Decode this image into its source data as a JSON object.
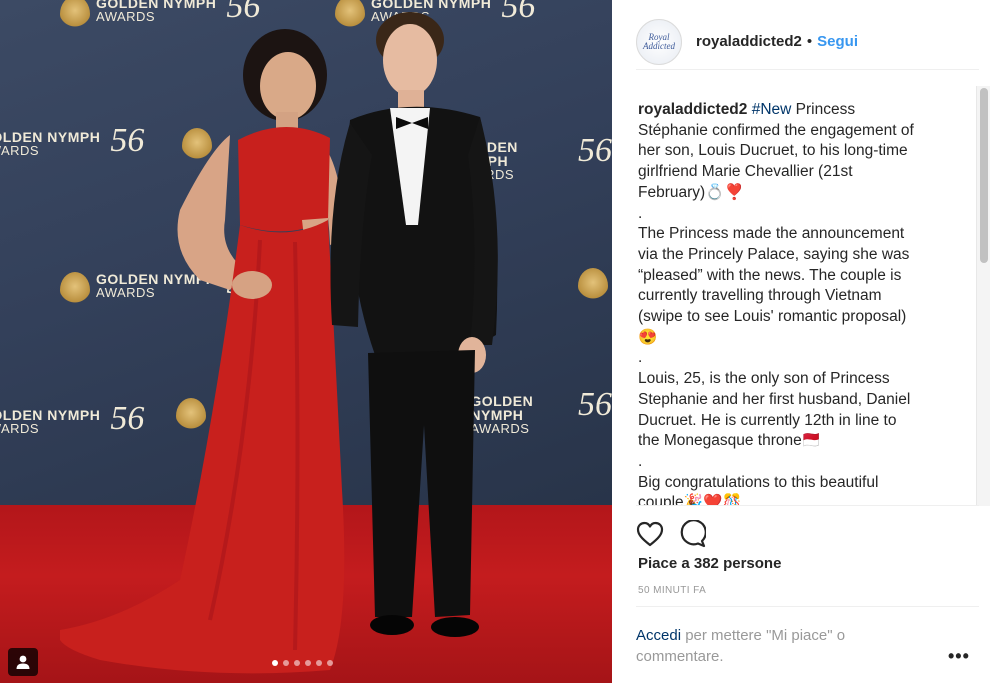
{
  "post": {
    "username": "royaladdicted2",
    "separator": "•",
    "follow_label": "Segui",
    "avatar_text": "Royal Addicted",
    "caption_author": "royaladdicted2",
    "caption_hashtag": "#New",
    "caption_lines": [
      " Princess\nStéphanie confirmed the engagement of\nher son, Louis Ducruet, to his long-time\ngirlfriend Marie Chevallier (21st\nFebruary)💍❣️\n.\nThe Princess made the announcement\nvia the Princely Palace, saying she was\n“pleased” with the news. The couple is\ncurrently travelling through Vietnam\n(swipe to see Louis' romantic proposal)\n😍\n.\nLouis, 25, is the only son of Princess\nStephanie and her first husband, Daniel\nDucruet. He is currently 12th in line to\nthe Monegasque throne🇲🇨\n.\nBig congratulations to this beautiful\ncouple🎉❤️🎊"
    ],
    "likes_text": "Piace a 382 persone",
    "time_text": "50 MINUTI FA",
    "login_label": "Accedi",
    "comment_prompt": " per mettere \"Mi piace\" o\ncommentare.",
    "more_label": "•••"
  },
  "photo": {
    "logo_line1": "GOLDEN NYMPH",
    "logo_line2": "AWARDS",
    "logo_num": "56",
    "carousel_count": 6,
    "carousel_active": 1
  },
  "colors": {
    "accent": "#3897f0",
    "link_dark": "#003569",
    "muted": "#999999",
    "dress": "#c8201d",
    "carpet": "#b3161a",
    "backdrop": "#33405a"
  },
  "icons": [
    "heart-icon",
    "comment-icon",
    "user-tag-icon",
    "more-options-icon"
  ]
}
